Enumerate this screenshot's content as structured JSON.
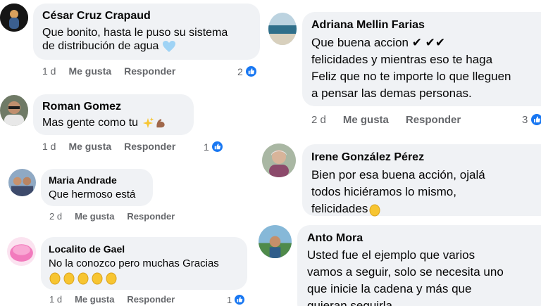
{
  "comments": [
    {
      "author": "César Cruz Crapaud",
      "lines": [
        "Que bonito, hasta le puso su sistema",
        "de distribución de agua"
      ],
      "age": "1 d",
      "like": "Me gusta",
      "reply": "Responder",
      "likes": "2",
      "emoji": "blue-heart-icon"
    },
    {
      "author": "Roman Gomez",
      "lines": [
        "Mas gente como tu"
      ],
      "age": "1 d",
      "like": "Me gusta",
      "reply": "Responder",
      "likes": "1",
      "emoji": "sparkles-and-flexed-arm-icon"
    },
    {
      "author": "Maria Andrade",
      "lines": [
        "Que hermoso está"
      ],
      "age": "2 d",
      "like": "Me gusta",
      "reply": "Responder"
    },
    {
      "author": "Localito de Gael",
      "lines": [
        "No la conozco pero muchas Gracias"
      ],
      "age": "1 d",
      "like": "Me gusta",
      "reply": "Responder",
      "likes": "1",
      "emoji": "clapping-hands-icon"
    },
    {
      "author": "Adriana Mellin Farias",
      "lines": [
        "Que buena accion ✔ ✔✔",
        "felicidades y mientras eso te haga",
        "Feliz que no te importe lo que lleguen",
        "a pensar las demas personas."
      ],
      "age": "2 d",
      "like": "Me gusta",
      "reply": "Responder",
      "likes": "3"
    },
    {
      "author": "Irene González Pérez",
      "lines": [
        "Bien por esa buena acción, ojalá",
        "todos hiciéramos lo mismo,",
        "felicidades"
      ],
      "emoji": "clapping-hands-icon"
    },
    {
      "author": "Anto Mora",
      "lines": [
        "Usted fue el ejemplo que varios",
        "vamos a seguir, solo se necesita uno",
        "que inicie la cadena y más que",
        "quieran seguirla"
      ]
    }
  ],
  "colors": {
    "bubble": "#f0f2f5",
    "like_blue": "#1877f2",
    "meta_gray": "#65676b"
  }
}
